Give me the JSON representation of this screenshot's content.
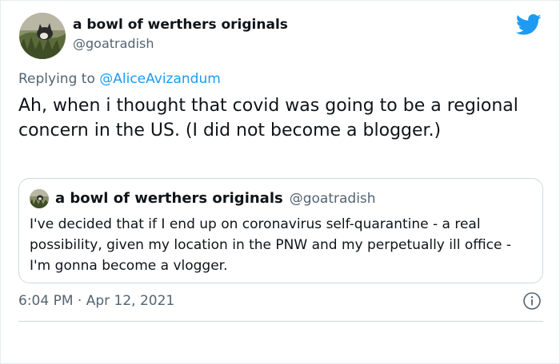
{
  "tweet": {
    "author": {
      "display_name": "a bowl of werthers originals",
      "handle": "@goatradish",
      "avatar_icon": "cat-in-grass-avatar"
    },
    "replying_to": {
      "prefix": "Replying to",
      "mention": "@AliceAvizandum"
    },
    "text": "Ah, when i thought that covid was going to be a regional concern in the US. (I did not become a blogger.)",
    "timestamp": "6:04 PM · Apr 12, 2021",
    "platform_icon": "twitter-bird-icon",
    "info_icon": "info-icon"
  },
  "quoted_tweet": {
    "author": {
      "display_name": "a bowl of werthers originals",
      "handle": "@goatradish"
    },
    "text": "I've decided that if I end up on coronavirus self-quarantine - a real possibility, given my location in the PNW and my perpetually ill office - I'm gonna become a vlogger."
  },
  "colors": {
    "accent": "#1d9bf0",
    "secondary_text": "#536471",
    "border": "#cfd9de"
  }
}
